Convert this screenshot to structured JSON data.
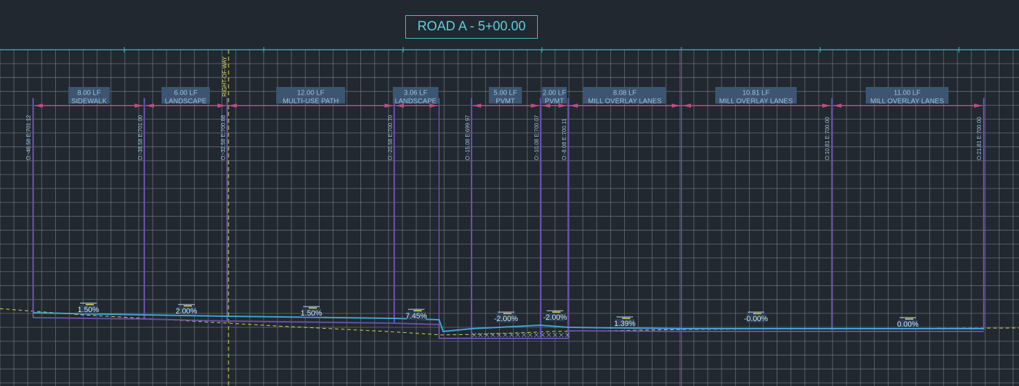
{
  "title": "ROAD A - 5+00.00",
  "right_of_way_label": "RIGHT-OF-WAY",
  "colors": {
    "background": "#212830",
    "grid": "#7d8590",
    "title": "#5fd0de",
    "boundary": "#6a50a8",
    "dimension": "#c04a86",
    "surface": "#3ea8d6",
    "existing_ground": "#e0d84a"
  },
  "segments": [
    {
      "width": "8.00 LF",
      "name": "SIDEWALK"
    },
    {
      "width": "6.00 LF",
      "name": "LANDSCAPE"
    },
    {
      "width": "12.00 LF",
      "name": "MULTI-USE PATH"
    },
    {
      "width": "3.06 LF",
      "name": "LANDSCAPE"
    },
    {
      "width": "5.00 LF",
      "name": "PVMT"
    },
    {
      "width": "2.00 LF",
      "name": "PVMT"
    },
    {
      "width": "8.08 LF",
      "name": "MILL OVERLAY LANES"
    },
    {
      "width": "10.81 LF",
      "name": "MILL OVERLAY LANES"
    },
    {
      "width": "11.00 LF",
      "name": "MILL OVERLAY LANES"
    }
  ],
  "offsets": [
    "O:-46.58 E:701.12",
    "O:-38.58 E:701.00",
    "O:-32.58 E:700.88",
    "O:-20.58 E:700.70",
    "O:-15.08 E:699.97",
    "O:-10.08 E:700.07",
    "O:-8.08 E:700.11",
    "O:10.81 E:700.00",
    "O:21.81 E:700.00"
  ],
  "grades": [
    "1.50%",
    "2.00%",
    "1.50%",
    "7.45%",
    "-2.00%",
    "-2.00%",
    "1.39%",
    "-0.00%",
    "0.00%"
  ]
}
